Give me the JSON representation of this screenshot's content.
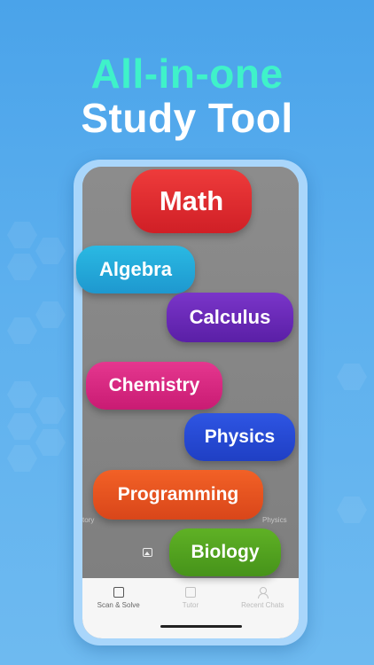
{
  "headline": {
    "line1": "All-in-one",
    "line2": "Study Tool"
  },
  "colors": {
    "background": "#4aa3ea",
    "headline_accent": "#3ff2c9",
    "headline_main": "#ffffff"
  },
  "subjects": [
    {
      "label": "Math",
      "color": "#d01f26"
    },
    {
      "label": "Algebra",
      "color": "#1e98cf"
    },
    {
      "label": "Calculus",
      "color": "#5a1fa6"
    },
    {
      "label": "Chemistry",
      "color": "#c91b73"
    },
    {
      "label": "Physics",
      "color": "#1f3fc4"
    },
    {
      "label": "Programming",
      "color": "#d9461a"
    },
    {
      "label": "Biology",
      "color": "#46931a"
    }
  ],
  "screen": {
    "background_chips": {
      "left": "tory",
      "right": "Physics"
    },
    "gallery_icon": "image-icon"
  },
  "tabbar": {
    "tabs": [
      {
        "label": "Scan & Solve",
        "icon": "scan-icon",
        "active": true
      },
      {
        "label": "Tutor",
        "icon": "chat-icon",
        "active": false
      },
      {
        "label": "Recent Chats",
        "icon": "user-icon",
        "active": false
      }
    ]
  }
}
